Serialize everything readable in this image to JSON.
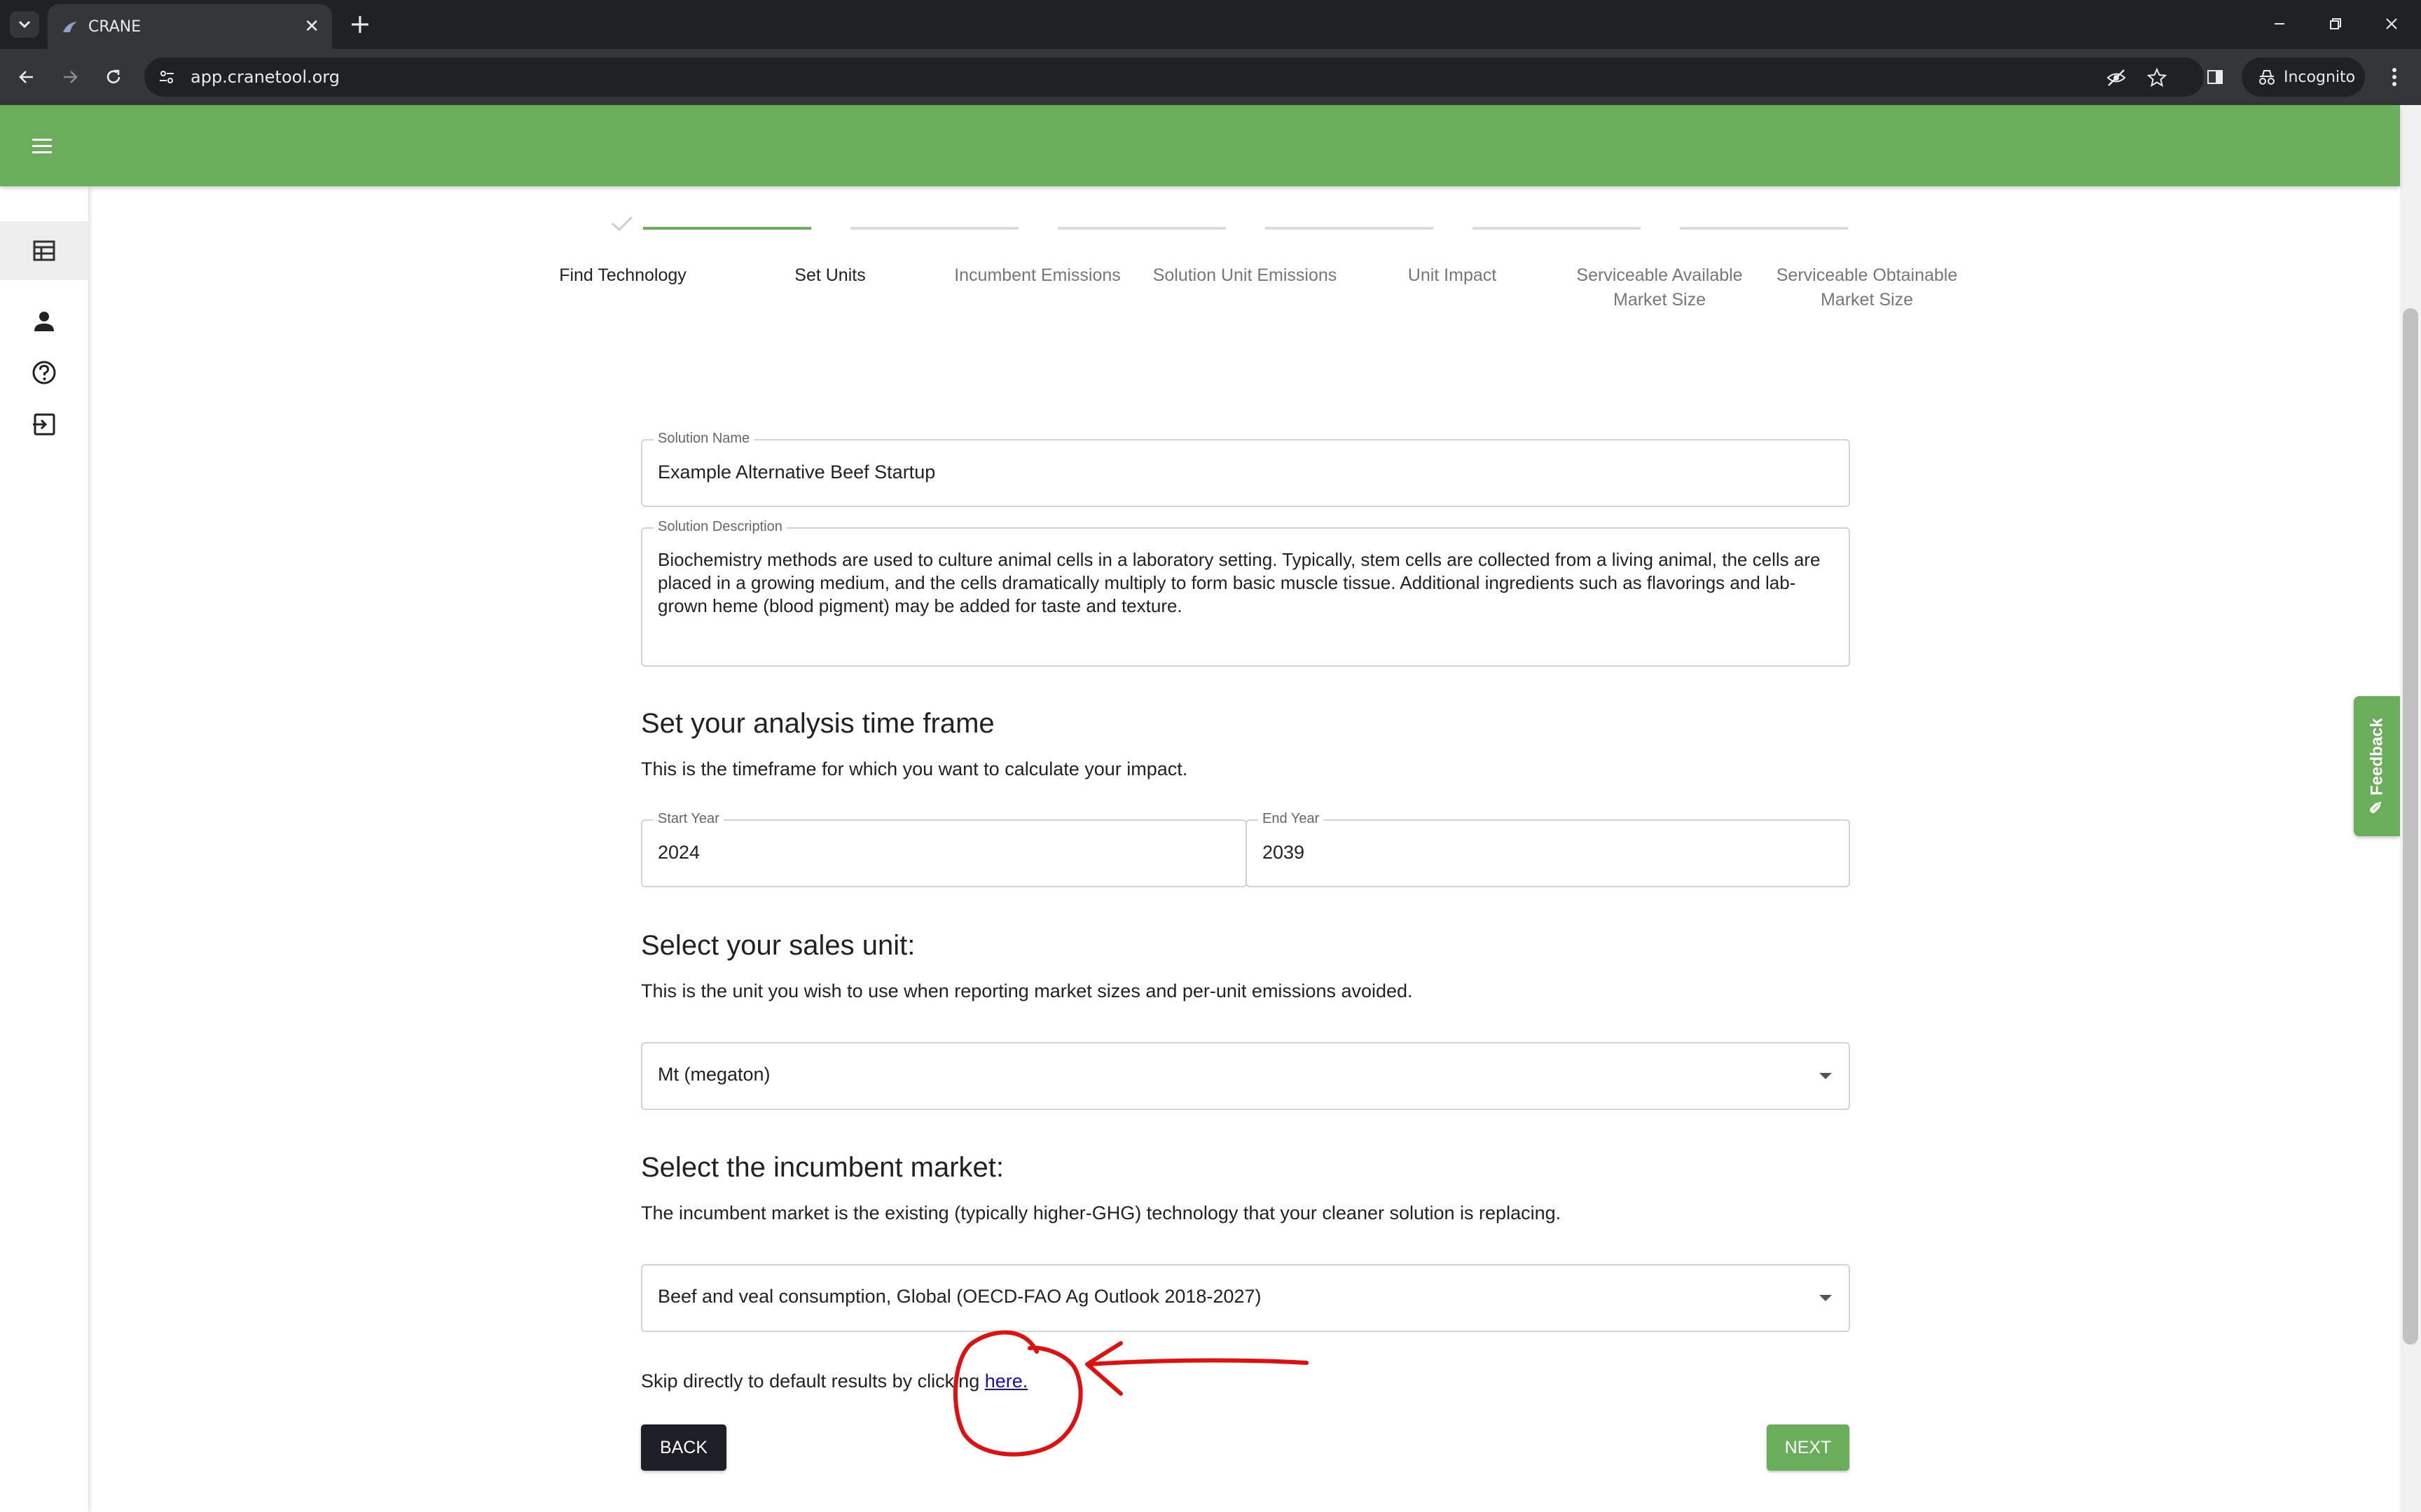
{
  "browser": {
    "tab_title": "CRANE",
    "url": "app.cranetool.org",
    "incognito_label": "Incognito"
  },
  "stepper": {
    "steps": [
      {
        "label": "Find Technology",
        "state": "done"
      },
      {
        "label": "Set Units",
        "state": "current"
      },
      {
        "label": "Incumbent Emissions",
        "state": "upcoming"
      },
      {
        "label": "Solution Unit Emissions",
        "state": "upcoming"
      },
      {
        "label": "Unit Impact",
        "state": "upcoming"
      },
      {
        "label": "Serviceable Available Market Size",
        "state": "upcoming"
      },
      {
        "label": "Serviceable Obtainable Market Size",
        "state": "upcoming"
      }
    ]
  },
  "form": {
    "solution_name": {
      "label": "Solution Name",
      "value": "Example Alternative Beef Startup"
    },
    "solution_description": {
      "label": "Solution Description",
      "value": "Biochemistry methods are used to culture animal cells in a laboratory setting. Typically, stem cells are collected from a living animal, the cells are placed in a growing medium, and the cells dramatically multiply to form basic muscle tissue. Additional ingredients such as flavorings and lab-grown heme (blood pigment) may be added for taste and texture."
    },
    "timeframe": {
      "heading": "Set your analysis time frame",
      "description": "This is the timeframe for which you want to calculate your impact.",
      "start_label": "Start Year",
      "start_value": "2024",
      "end_label": "End Year",
      "end_value": "2039"
    },
    "sales_unit": {
      "heading": "Select your sales unit:",
      "description": "This is the unit you wish to use when reporting market sizes and per-unit emissions avoided.",
      "selected": "Mt (megaton)"
    },
    "incumbent_market": {
      "heading": "Select the incumbent market:",
      "description": "The incumbent market is the existing (typically higher-GHG) technology that your cleaner solution is replacing.",
      "selected": "Beef and veal consumption, Global (OECD-FAO Ag Outlook 2018-2027)"
    },
    "skip_text": "Skip directly to default results by clicking ",
    "skip_link": "here.",
    "back_label": "BACK",
    "next_label": "NEXT"
  },
  "feedback_label": "Feedback",
  "colors": {
    "brand_green": "#6aad5a",
    "annotation_red": "#e01010",
    "dark_button": "#1e1f26"
  }
}
